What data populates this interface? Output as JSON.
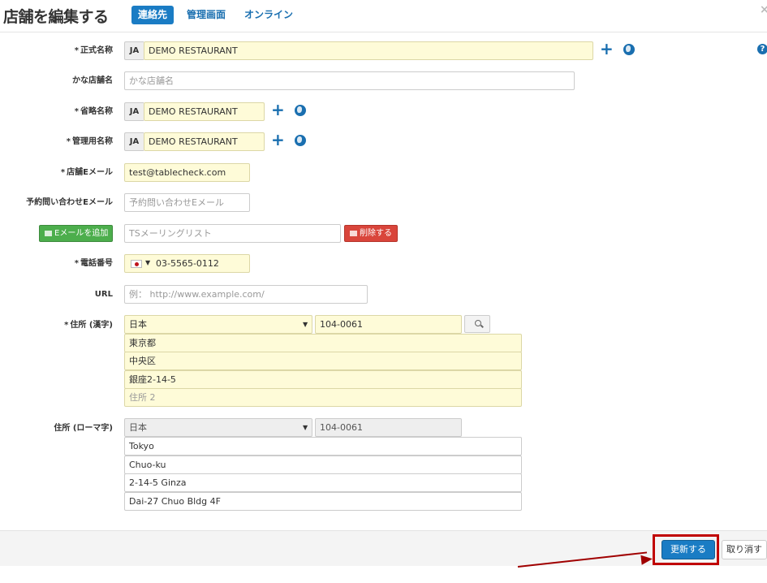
{
  "header": {
    "title": "店舗を編集する",
    "tabs": [
      {
        "label": "連絡先",
        "active": true
      },
      {
        "label": "管理画面",
        "active": false
      },
      {
        "label": "オンライン",
        "active": false
      }
    ],
    "close_glyph": "×"
  },
  "form": {
    "official_name": {
      "label": "正式名称",
      "lang": "JA",
      "value": "DEMO RESTAURANT"
    },
    "kana_name": {
      "label": "かな店舗名",
      "placeholder": "かな店舗名"
    },
    "short_name": {
      "label": "省略名称",
      "lang": "JA",
      "value": "DEMO RESTAURANT"
    },
    "admin_name": {
      "label": "管理用名称",
      "lang": "JA",
      "value": "DEMO RESTAURANT"
    },
    "store_email": {
      "label": "店舗Eメール",
      "value": "test@tablecheck.com"
    },
    "inquiry_email": {
      "label": "予約問い合わせEメール",
      "placeholder": "予約問い合わせEメール"
    },
    "mailing_list": {
      "add_button": "Eメールを追加",
      "placeholder": "TSメーリングリスト",
      "delete_button": "削除する"
    },
    "phone": {
      "label": "電話番号",
      "value": "03-5565-0112"
    },
    "url": {
      "label": "URL",
      "placeholder": "例： http://www.example.com/"
    },
    "address_kanji": {
      "label": "住所 (漢字)",
      "country": "日本",
      "postal": "104-0061",
      "lines": [
        "東京都",
        "中央区",
        "銀座2-14-5"
      ],
      "line4_placeholder": "住所 2"
    },
    "address_roman": {
      "label": "住所 (ローマ字)",
      "country": "日本",
      "postal": "104-0061",
      "lines": [
        "Tokyo",
        "Chuo-ku",
        "2-14-5 Ginza",
        "Dai-27 Chuo Bldg 4F"
      ]
    },
    "required_mark": "*",
    "help_glyph": "?"
  },
  "footer": {
    "update_button": "更新する",
    "cancel_button": "取り消す"
  },
  "colors": {
    "accent": "#1a7cc4",
    "required_bg": "#fefbd8",
    "highlight": "#c00000",
    "green": "#4cae4c",
    "red": "#d9453b"
  },
  "icons": {
    "add": "plus-icon",
    "translate": "globe-icon",
    "help": "question-icon",
    "search": "search-icon",
    "flag": "japan-flag-icon"
  }
}
